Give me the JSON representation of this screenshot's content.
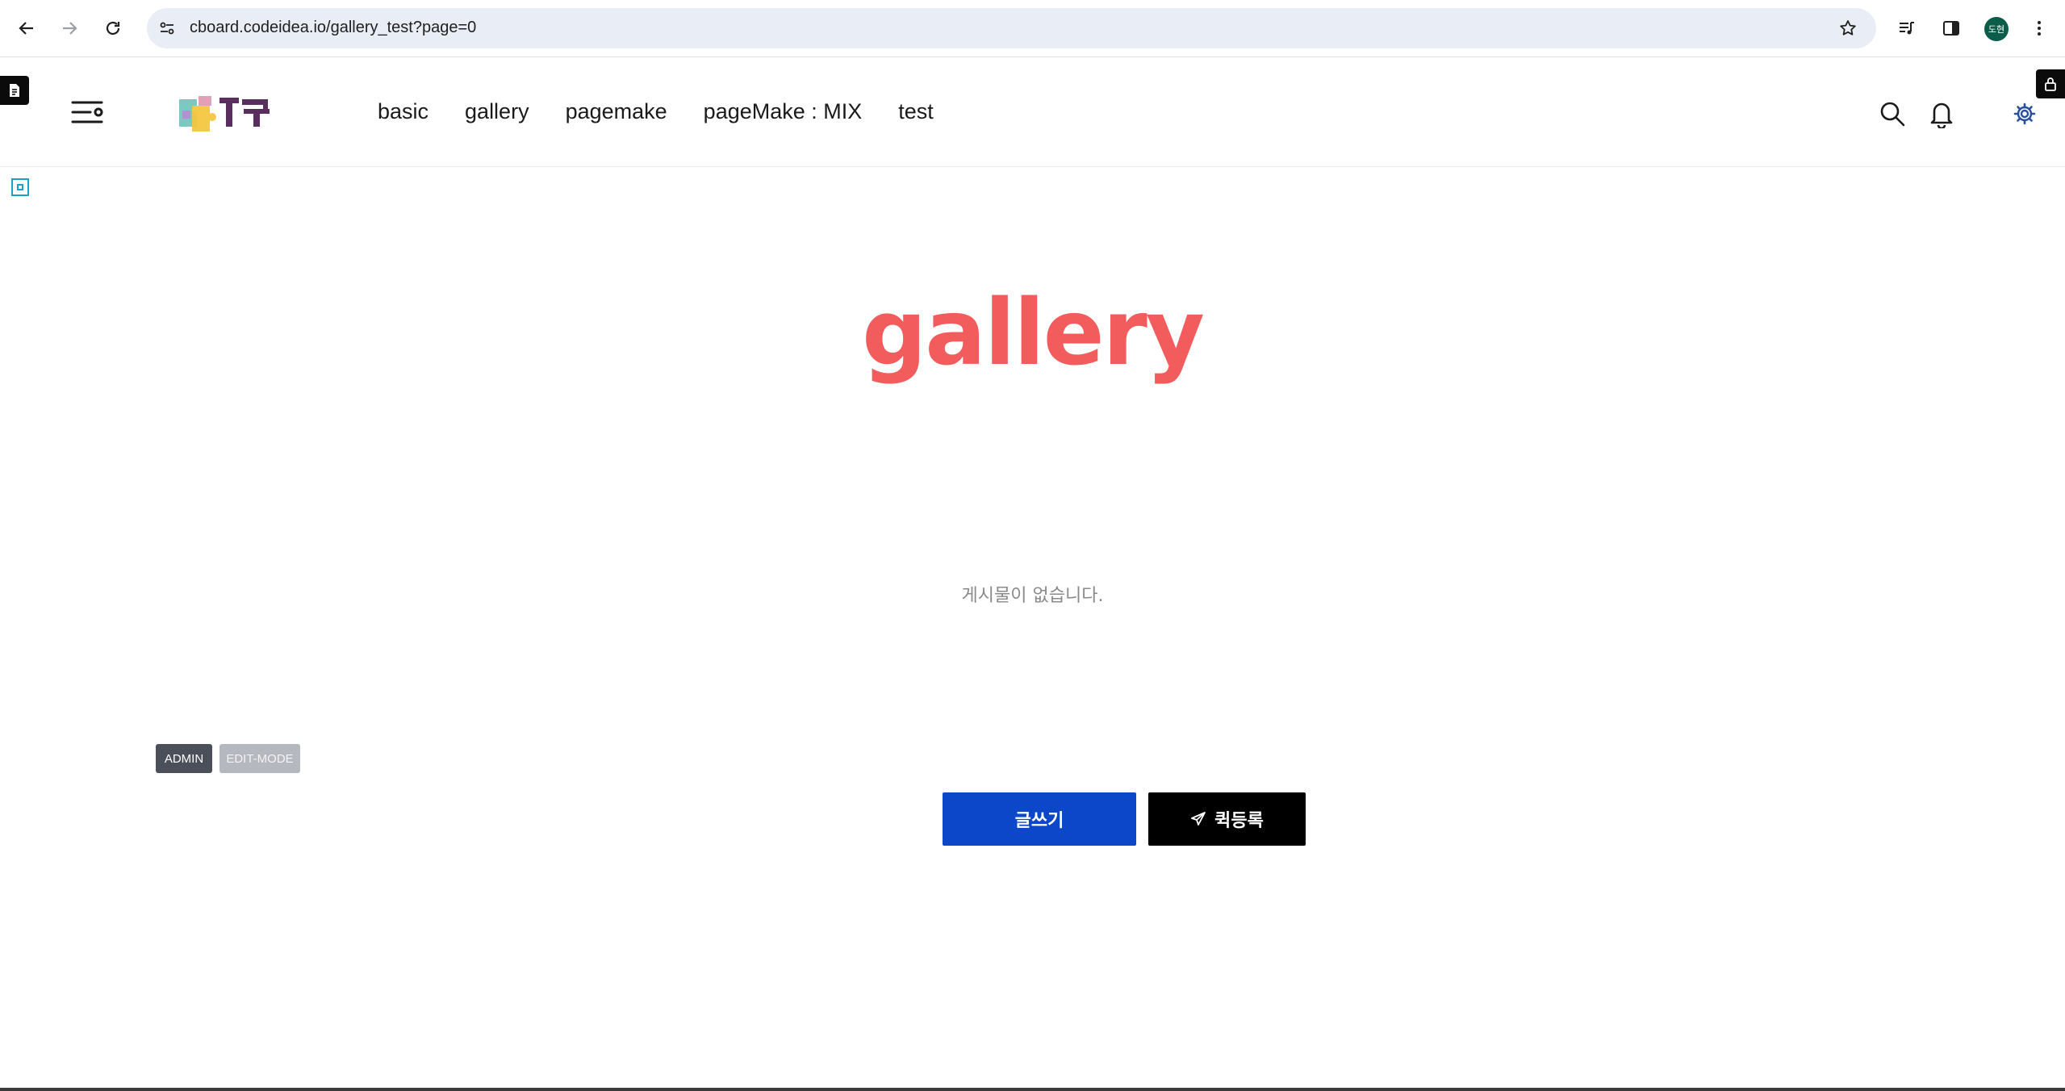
{
  "browser": {
    "url": "cboard.codeidea.io/gallery_test?page=0",
    "profile_initials": "도현",
    "icons": [
      "back-arrow-icon",
      "forward-arrow-icon",
      "reload-icon",
      "site-info-icon",
      "bookmark-star-icon",
      "media-icon",
      "side-panel-icon",
      "menu-dots-icon"
    ]
  },
  "header": {
    "nav_items": [
      "basic",
      "gallery",
      "pagemake",
      "pageMake : MIX",
      "test"
    ]
  },
  "main": {
    "title": "gallery",
    "empty_message": "게시물이 없습니다.",
    "admin_tag": "ADMIN",
    "edit_tag": "EDIT-MODE",
    "write_button": "글쓰기",
    "quick_button": "퀵등록"
  },
  "colors": {
    "title": "#f25c5c",
    "write_button": "#0b47c8",
    "quick_button": "#000000"
  }
}
